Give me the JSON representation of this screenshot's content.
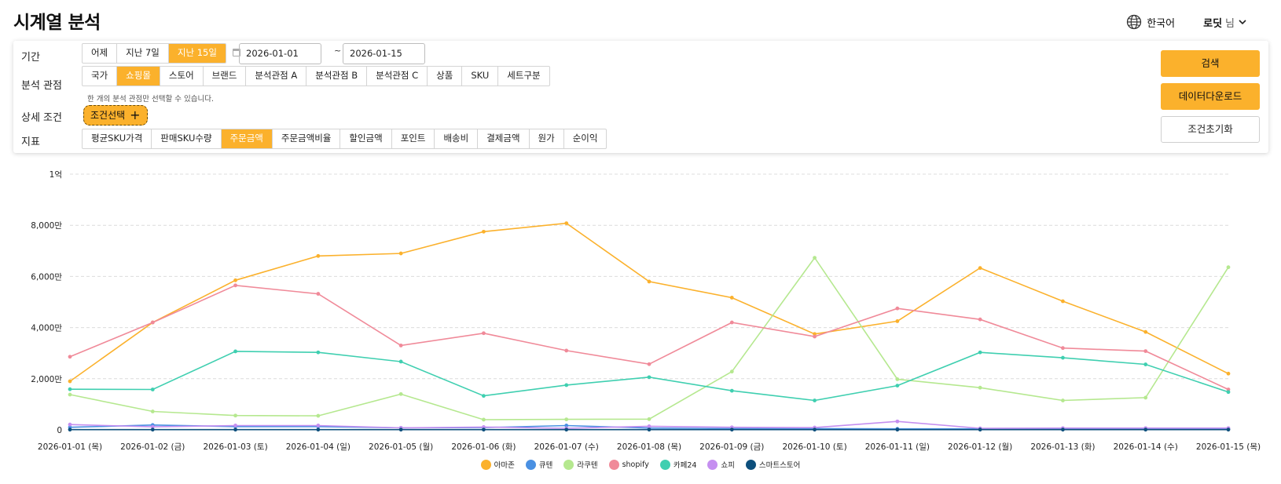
{
  "header": {
    "title": "시계열 분석",
    "language": "한국어",
    "user_name": "로딧",
    "user_suffix": "님"
  },
  "filters": {
    "period": {
      "label": "기간",
      "options": [
        "어제",
        "지난 7일",
        "지난 15일"
      ],
      "active_index": 2,
      "start_date": "2026-01-01",
      "end_date": "2026-01-15",
      "separator": "~"
    },
    "perspective": {
      "label": "분석 관점",
      "options": [
        "국가",
        "쇼핑몰",
        "스토어",
        "브랜드",
        "분석관점 A",
        "분석관점 B",
        "분석관점 C",
        "상품",
        "SKU",
        "세트구분"
      ],
      "active_index": 1,
      "hint": "한 개의 분석 관점만 선택할 수 있습니다."
    },
    "detail": {
      "label": "상세 조건",
      "button": "조건선택",
      "plus": "+"
    },
    "metric": {
      "label": "지표",
      "options": [
        "평균SKU가격",
        "판매SKU수량",
        "주문금액",
        "주문금액비율",
        "할인금액",
        "포인트",
        "배송비",
        "결제금액",
        "원가",
        "순이익"
      ],
      "active_index": 2
    }
  },
  "actions": {
    "search": "검색",
    "download": "데이터다운로드",
    "reset": "조건초기화"
  },
  "chart_data": {
    "type": "line",
    "categories": [
      "2026-01-01 (목)",
      "2026-01-02 (금)",
      "2026-01-03 (토)",
      "2026-01-04 (일)",
      "2026-01-05 (월)",
      "2026-01-06 (화)",
      "2026-01-07 (수)",
      "2026-01-08 (목)",
      "2026-01-09 (금)",
      "2026-01-10 (토)",
      "2026-01-11 (일)",
      "2026-01-12 (월)",
      "2026-01-13 (화)",
      "2026-01-14 (수)",
      "2026-01-15 (목)"
    ],
    "ylim": [
      0,
      100000000
    ],
    "yticks": [
      0,
      20000000,
      40000000,
      60000000,
      80000000,
      100000000
    ],
    "ytick_labels": [
      "0",
      "2,000만",
      "4,000만",
      "6,000만",
      "8,000만",
      "1억"
    ],
    "grid": true,
    "legend_position": "bottom",
    "series": [
      {
        "name": "아마존",
        "color": "#fbb12c",
        "values": [
          19000000,
          42000000,
          58500000,
          68000000,
          69000000,
          77500000,
          80800000,
          58000000,
          51700000,
          37500000,
          42500000,
          63300000,
          50300000,
          38300000,
          22000000
        ]
      },
      {
        "name": "큐텐",
        "color": "#4a90e2",
        "values": [
          1000000,
          1900000,
          1300000,
          1300000,
          800000,
          900000,
          1700000,
          700000,
          500000,
          500000,
          400000,
          400000,
          500000,
          500000,
          400000
        ]
      },
      {
        "name": "라쿠텐",
        "color": "#b5e88f",
        "values": [
          13800000,
          7200000,
          5600000,
          5500000,
          14000000,
          4000000,
          4100000,
          4200000,
          22800000,
          67300000,
          19800000,
          16500000,
          11500000,
          12600000,
          63600000
        ]
      },
      {
        "name": "shopify",
        "color": "#f08a99",
        "values": [
          28600000,
          42000000,
          56500000,
          53200000,
          33000000,
          37800000,
          31000000,
          25700000,
          42000000,
          36500000,
          47500000,
          43200000,
          32000000,
          30800000,
          15800000
        ]
      },
      {
        "name": "카페24",
        "color": "#3fcfb0",
        "values": [
          15900000,
          15800000,
          30700000,
          30300000,
          26700000,
          13300000,
          17500000,
          20600000,
          15300000,
          11500000,
          17300000,
          30300000,
          28200000,
          25600000,
          14800000
        ]
      },
      {
        "name": "쇼피",
        "color": "#c58ff0",
        "values": [
          2100000,
          1200000,
          1700000,
          1700000,
          800000,
          1100000,
          600000,
          1400000,
          1000000,
          900000,
          3300000,
          600000,
          700000,
          700000,
          700000
        ]
      },
      {
        "name": "스마트스토어",
        "color": "#0d4f7c",
        "values": [
          100000,
          100000,
          100000,
          100000,
          100000,
          100000,
          100000,
          100000,
          100000,
          100000,
          100000,
          100000,
          100000,
          100000,
          100000
        ]
      }
    ]
  }
}
